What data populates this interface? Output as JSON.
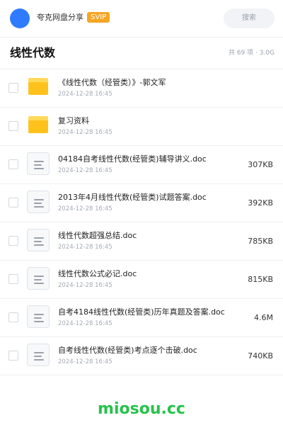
{
  "header": {
    "brand": "夸克网盘分享",
    "badge": "SVIP",
    "search_placeholder": "搜索"
  },
  "title_row": {
    "title": "线性代数",
    "summary": "共 69 项 · 3.0G"
  },
  "files": [
    {
      "type": "folder",
      "name": "《线性代数（经管类）》-郭文军",
      "date": "2024-12-28 16:45",
      "size": ""
    },
    {
      "type": "folder",
      "name": "复习资料",
      "date": "2024-12-28 16:45",
      "size": ""
    },
    {
      "type": "doc",
      "name": "04184自考线性代数(经管类)辅导讲义.doc",
      "date": "2024-12-28 16:45",
      "size": "307KB"
    },
    {
      "type": "doc",
      "name": "2013年4月线性代数(经管类)试题答案.doc",
      "date": "2024-12-28 16:45",
      "size": "392KB"
    },
    {
      "type": "doc",
      "name": "线性代数超强总结.doc",
      "date": "2024-12-28 16:45",
      "size": "785KB"
    },
    {
      "type": "doc",
      "name": "线性代数公式必记.doc",
      "date": "2024-12-28 16:45",
      "size": "815KB"
    },
    {
      "type": "doc",
      "name": "自考4184线性代数(经管类)历年真题及答案.doc",
      "date": "2024-12-28 16:45",
      "size": "4.6M"
    },
    {
      "type": "doc",
      "name": "自考线性代数(经管类)考点逐个击破.doc",
      "date": "2024-12-28 16:45",
      "size": "740KB"
    }
  ],
  "icons": {
    "folder": "folder-icon",
    "doc": "document-icon"
  },
  "watermark": "miosou.cc",
  "colors": {
    "logo": "#2f7bff",
    "badge": "#f5a623",
    "folder": "#ffc21c",
    "watermark": "#27c24c"
  }
}
